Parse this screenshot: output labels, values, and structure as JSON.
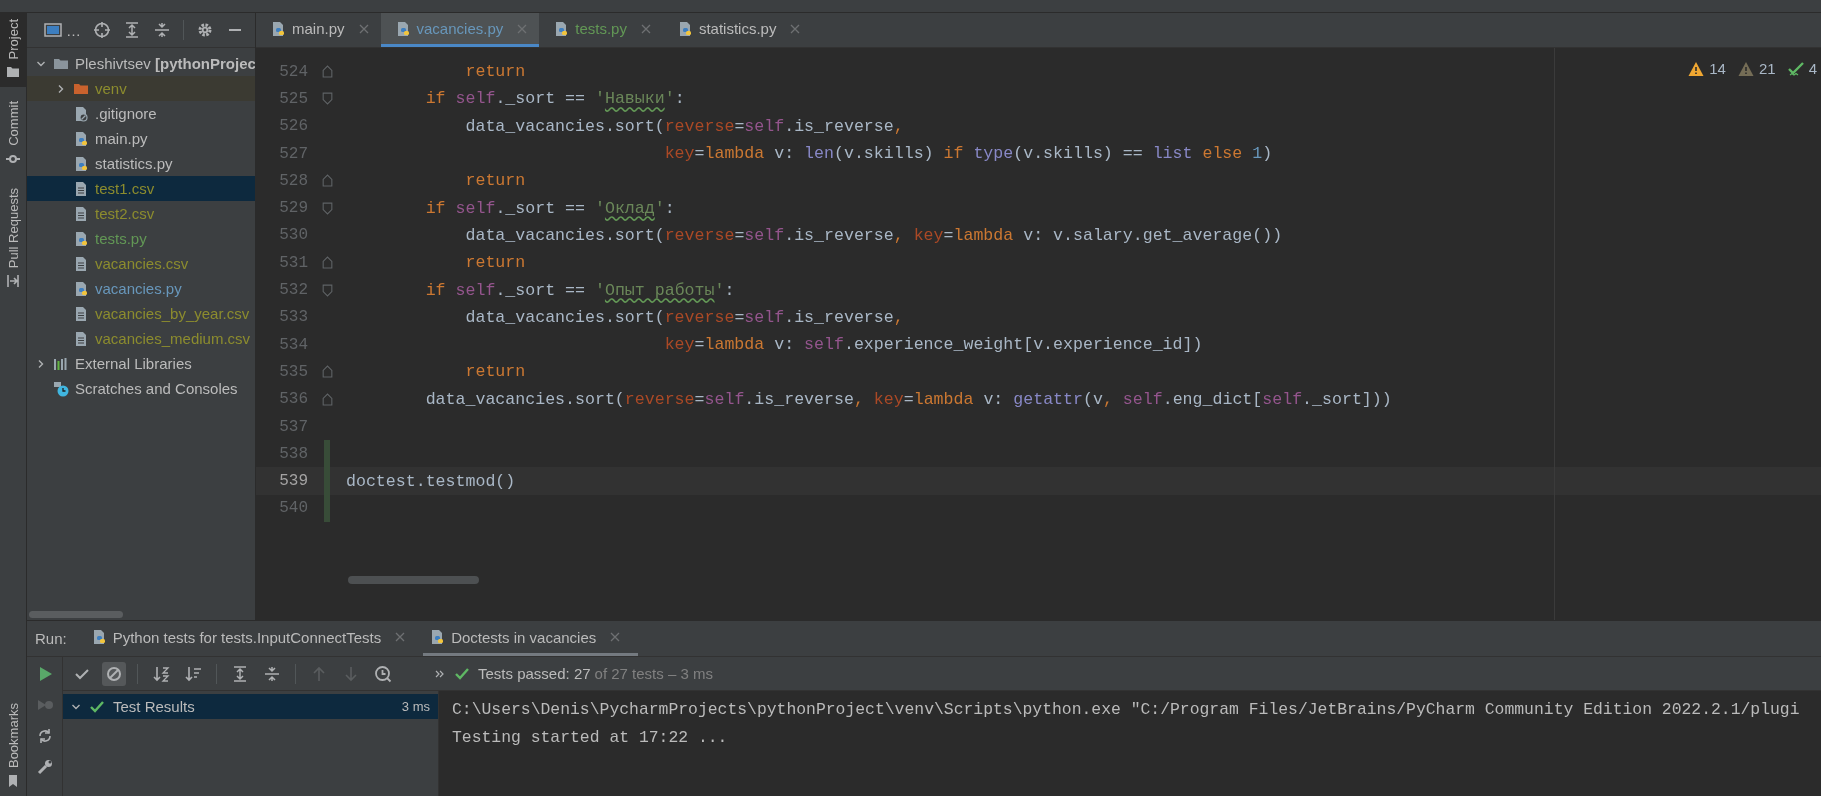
{
  "tool_strip": {
    "top": [
      {
        "label": "Project",
        "kind": "project",
        "selected": true
      },
      {
        "label": "Commit",
        "kind": "commit",
        "selected": false
      },
      {
        "label": "Pull Requests",
        "kind": "pull",
        "selected": false
      }
    ],
    "bottom": [
      {
        "label": "Bookmarks",
        "kind": "bookmarks",
        "selected": false
      }
    ]
  },
  "project": {
    "view_label": "…",
    "tree": [
      {
        "label": "Pleshivtsev **[pythonProjec**",
        "kind": "folder",
        "color": "#bbbbbb",
        "expanded": true,
        "selected": false,
        "children": [
          {
            "label": "venv",
            "kind": "excluded-folder",
            "color": "#8c8c2e",
            "expanded": false,
            "selected": false
          },
          {
            "label": ".gitignore",
            "kind": "ignore-file",
            "color": "#bbbbbb",
            "selected": false
          },
          {
            "label": "main.py",
            "kind": "python-file",
            "color": "#bbbbbb",
            "selected": false
          },
          {
            "label": "statistics.py",
            "kind": "python-file",
            "color": "#bbbbbb",
            "selected": false
          },
          {
            "label": "test1.csv",
            "kind": "text-file",
            "color": "#8c8c2e",
            "selected": true
          },
          {
            "label": "test2.csv",
            "kind": "text-file",
            "color": "#8c8c2e",
            "selected": false
          },
          {
            "label": "tests.py",
            "kind": "python-file",
            "color": "#629755",
            "selected": false
          },
          {
            "label": "vacancies.csv",
            "kind": "text-file",
            "color": "#8c8c2e",
            "selected": false
          },
          {
            "label": "vacancies.py",
            "kind": "python-file",
            "color": "#6897bb",
            "selected": false
          },
          {
            "label": "vacancies_by_year.csv",
            "kind": "text-file",
            "color": "#8c8c2e",
            "selected": false
          },
          {
            "label": "vacancies_medium.csv",
            "kind": "text-file",
            "color": "#8c8c2e",
            "selected": false
          }
        ]
      },
      {
        "label": "External Libraries",
        "kind": "library",
        "color": "#bbbbbb",
        "expanded": false,
        "selected": false
      },
      {
        "label": "Scratches and Consoles",
        "kind": "scratches",
        "color": "#bbbbbb",
        "selected": false
      }
    ]
  },
  "editor": {
    "tabs": [
      {
        "label": "main.py",
        "color": "#bbbbbb",
        "selected": false
      },
      {
        "label": "vacancies.py",
        "color": "#6897bb",
        "selected": true
      },
      {
        "label": "tests.py",
        "color": "#629755",
        "selected": false
      },
      {
        "label": "statistics.py",
        "color": "#bbbbbb",
        "selected": false
      }
    ],
    "inspections": [
      {
        "kind": "warning",
        "count": "14"
      },
      {
        "kind": "weak-warning",
        "count": "21"
      },
      {
        "kind": "ok",
        "count": "4"
      }
    ],
    "lines": [
      {
        "number": "524",
        "fold_end": true,
        "tokens": [
          {
            "text": "            return",
            "kind": "kw"
          }
        ]
      },
      {
        "number": "525",
        "fold_start": true,
        "tokens": [
          {
            "text": "        if ",
            "kind": "kw"
          },
          {
            "text": "self",
            "kind": "self"
          },
          {
            "text": "._sort == ",
            "kind": "plain"
          },
          {
            "text": "'",
            "kind": "str"
          },
          {
            "text": "Навыки",
            "kind": "str",
            "typo": true
          },
          {
            "text": "'",
            "kind": "str"
          },
          {
            "text": ":",
            "kind": "plain"
          }
        ]
      },
      {
        "number": "526",
        "tokens": [
          {
            "text": "            data_vacancies.sort(",
            "kind": "plain"
          },
          {
            "text": "reverse",
            "kind": "param"
          },
          {
            "text": "=",
            "kind": "plain"
          },
          {
            "text": "self",
            "kind": "self"
          },
          {
            "text": ".is_reverse",
            "kind": "plain"
          },
          {
            "text": ",",
            "kind": "kw"
          }
        ]
      },
      {
        "number": "527",
        "tokens": [
          {
            "text": "                                key",
            "kind": "param"
          },
          {
            "text": "=",
            "kind": "plain"
          },
          {
            "text": "lambda",
            "kind": "kw"
          },
          {
            "text": " v: ",
            "kind": "plain"
          },
          {
            "text": "len",
            "kind": "builtin"
          },
          {
            "text": "(v.skills) ",
            "kind": "plain"
          },
          {
            "text": "if ",
            "kind": "kw"
          },
          {
            "text": "type",
            "kind": "builtin"
          },
          {
            "text": "(v.skills) == ",
            "kind": "plain"
          },
          {
            "text": "list ",
            "kind": "builtin"
          },
          {
            "text": "else ",
            "kind": "kw"
          },
          {
            "text": "1",
            "kind": "num"
          },
          {
            "text": ")",
            "kind": "plain"
          }
        ]
      },
      {
        "number": "528",
        "fold_end": true,
        "tokens": [
          {
            "text": "            return",
            "kind": "kw"
          }
        ]
      },
      {
        "number": "529",
        "fold_start": true,
        "tokens": [
          {
            "text": "        if ",
            "kind": "kw"
          },
          {
            "text": "self",
            "kind": "self"
          },
          {
            "text": "._sort == ",
            "kind": "plain"
          },
          {
            "text": "'",
            "kind": "str"
          },
          {
            "text": "Оклад",
            "kind": "str",
            "typo": true
          },
          {
            "text": "'",
            "kind": "str"
          },
          {
            "text": ":",
            "kind": "plain"
          }
        ]
      },
      {
        "number": "530",
        "tokens": [
          {
            "text": "            data_vacancies.sort(",
            "kind": "plain"
          },
          {
            "text": "reverse",
            "kind": "param"
          },
          {
            "text": "=",
            "kind": "plain"
          },
          {
            "text": "self",
            "kind": "self"
          },
          {
            "text": ".is_reverse",
            "kind": "plain"
          },
          {
            "text": ", ",
            "kind": "kw"
          },
          {
            "text": "key",
            "kind": "param"
          },
          {
            "text": "=",
            "kind": "plain"
          },
          {
            "text": "lambda",
            "kind": "kw"
          },
          {
            "text": " v: v.salary.get_average())",
            "kind": "plain"
          }
        ]
      },
      {
        "number": "531",
        "fold_end": true,
        "tokens": [
          {
            "text": "            return",
            "kind": "kw"
          }
        ]
      },
      {
        "number": "532",
        "fold_start": true,
        "tokens": [
          {
            "text": "        if ",
            "kind": "kw"
          },
          {
            "text": "self",
            "kind": "self"
          },
          {
            "text": "._sort == ",
            "kind": "plain"
          },
          {
            "text": "'",
            "kind": "str"
          },
          {
            "text": "Опыт работы",
            "kind": "str",
            "typo": true
          },
          {
            "text": "'",
            "kind": "str"
          },
          {
            "text": ":",
            "kind": "plain"
          }
        ]
      },
      {
        "number": "533",
        "tokens": [
          {
            "text": "            data_vacancies.sort(",
            "kind": "plain"
          },
          {
            "text": "reverse",
            "kind": "param"
          },
          {
            "text": "=",
            "kind": "plain"
          },
          {
            "text": "self",
            "kind": "self"
          },
          {
            "text": ".is_reverse",
            "kind": "plain"
          },
          {
            "text": ",",
            "kind": "kw"
          }
        ]
      },
      {
        "number": "534",
        "tokens": [
          {
            "text": "                                key",
            "kind": "param"
          },
          {
            "text": "=",
            "kind": "plain"
          },
          {
            "text": "lambda",
            "kind": "kw"
          },
          {
            "text": " v: ",
            "kind": "plain"
          },
          {
            "text": "self",
            "kind": "self"
          },
          {
            "text": ".experience_weight[v.experience_id])",
            "kind": "plain"
          }
        ]
      },
      {
        "number": "535",
        "fold_end": true,
        "tokens": [
          {
            "text": "            return",
            "kind": "kw"
          }
        ]
      },
      {
        "number": "536",
        "fold_end": true,
        "tokens": [
          {
            "text": "        data_vacancies.sort(",
            "kind": "plain"
          },
          {
            "text": "reverse",
            "kind": "param"
          },
          {
            "text": "=",
            "kind": "plain"
          },
          {
            "text": "self",
            "kind": "self"
          },
          {
            "text": ".is_reverse",
            "kind": "plain"
          },
          {
            "text": ", ",
            "kind": "kw"
          },
          {
            "text": "key",
            "kind": "param"
          },
          {
            "text": "=",
            "kind": "plain"
          },
          {
            "text": "lambda",
            "kind": "kw"
          },
          {
            "text": " v: ",
            "kind": "plain"
          },
          {
            "text": "getattr",
            "kind": "builtin"
          },
          {
            "text": "(v",
            "kind": "plain"
          },
          {
            "text": ", ",
            "kind": "kw"
          },
          {
            "text": "self",
            "kind": "self"
          },
          {
            "text": ".eng_dict[",
            "kind": "plain"
          },
          {
            "text": "self",
            "kind": "self"
          },
          {
            "text": "._sort]))",
            "kind": "plain"
          }
        ]
      },
      {
        "number": "537"
      },
      {
        "number": "538",
        "changed": true
      },
      {
        "number": "539",
        "changed": true,
        "current": true,
        "tokens": [
          {
            "text": "doctest.testmod()",
            "kind": "plain"
          }
        ]
      },
      {
        "number": "540",
        "changed": true
      }
    ]
  },
  "run": {
    "label": "Run:",
    "tabs": [
      {
        "label": "Python tests for tests.InputConnectTests",
        "selected": false
      },
      {
        "label": "Doctests in vacancies",
        "selected": true
      }
    ],
    "status": {
      "passed": "Tests passed: 27",
      "rest": "of 27 tests – 3 ms"
    },
    "results": [
      {
        "label": "Test Results",
        "time": "3 ms",
        "passed": true,
        "expanded": true,
        "selected": true
      }
    ],
    "console": [
      "C:\\Users\\Denis\\PycharmProjects\\pythonProject\\venv\\Scripts\\python.exe \"C:/Program Files/JetBrains/PyCharm Community Edition 2022.2.1/plugi",
      "Testing started at 17:22 ..."
    ]
  }
}
